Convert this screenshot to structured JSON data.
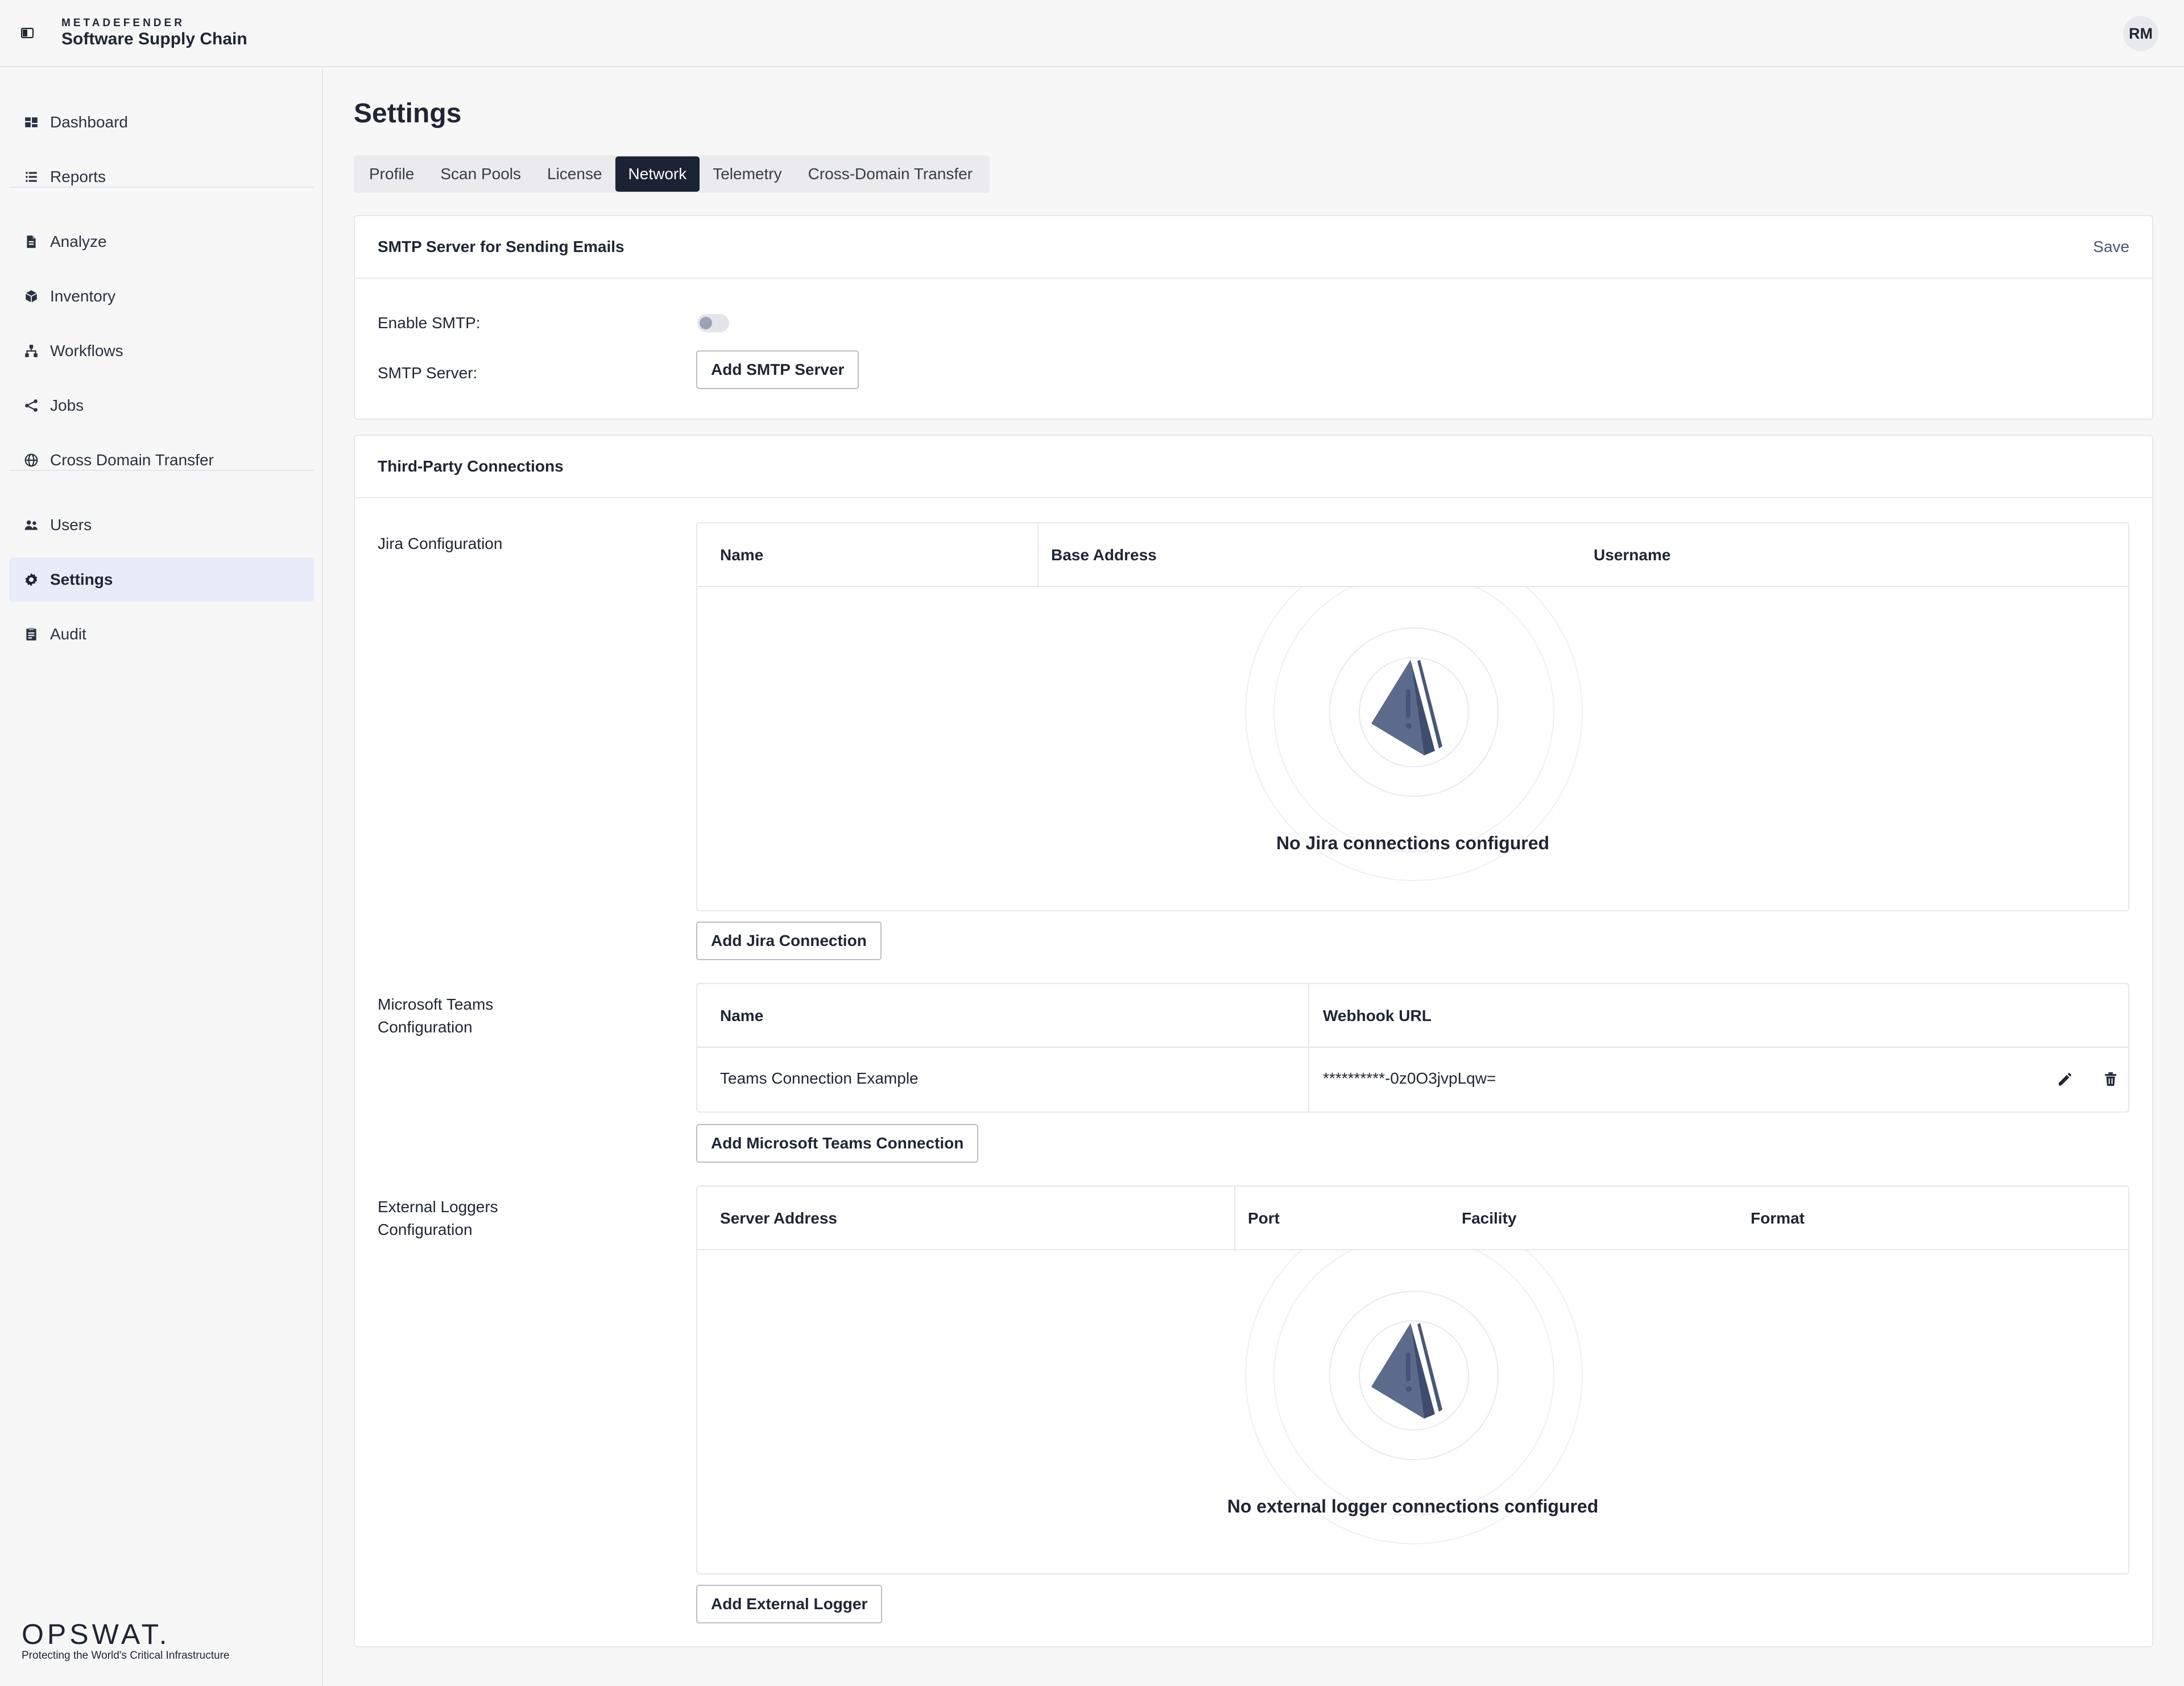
{
  "app": {
    "brand_small": "METADEFENDER",
    "brand_title": "Software Supply Chain",
    "user_initials": "RM"
  },
  "sidebar": {
    "items": [
      {
        "label": "Dashboard",
        "icon": "dashboard-icon"
      },
      {
        "label": "Reports",
        "icon": "reports-icon"
      },
      {
        "label": "Analyze",
        "icon": "analyze-icon"
      },
      {
        "label": "Inventory",
        "icon": "inventory-icon"
      },
      {
        "label": "Workflows",
        "icon": "workflows-icon"
      },
      {
        "label": "Jobs",
        "icon": "jobs-icon"
      },
      {
        "label": "Cross Domain Transfer",
        "icon": "globe-icon"
      },
      {
        "label": "Users",
        "icon": "users-icon"
      },
      {
        "label": "Settings",
        "icon": "gear-icon"
      },
      {
        "label": "Audit",
        "icon": "audit-icon"
      }
    ],
    "active": "Settings",
    "footer_logo": "OPSWAT.",
    "footer_tagline": "Protecting the World's Critical Infrastructure"
  },
  "page": {
    "title": "Settings",
    "tabs": [
      "Profile",
      "Scan Pools",
      "License",
      "Network",
      "Telemetry",
      "Cross-Domain Transfer"
    ],
    "active_tab": "Network"
  },
  "smtp": {
    "title": "SMTP Server for Sending Emails",
    "save_label": "Save",
    "enable_label": "Enable SMTP:",
    "server_label": "SMTP Server:",
    "add_button": "Add SMTP Server",
    "enabled": false
  },
  "third_party": {
    "title": "Third-Party Connections",
    "jira": {
      "label": "Jira Configuration",
      "columns": [
        "Name",
        "Base Address",
        "Username"
      ],
      "empty_message": "No Jira connections configured",
      "add_button": "Add Jira Connection"
    },
    "teams": {
      "label_line1": "Microsoft Teams",
      "label_line2": "Configuration",
      "columns": [
        "Name",
        "Webhook URL"
      ],
      "rows": [
        {
          "name": "Teams Connection Example",
          "webhook": "**********-0z0O3jvpLqw="
        }
      ],
      "add_button": "Add Microsoft Teams Connection"
    },
    "loggers": {
      "label_line1": "External Loggers",
      "label_line2": "Configuration",
      "columns": [
        "Server Address",
        "Port",
        "Facility",
        "Format"
      ],
      "empty_message": "No external logger connections configured",
      "add_button": "Add External Logger"
    }
  },
  "colors": {
    "accent_dark": "#1b2233",
    "active_nav_bg": "#e8ecf9",
    "illustration": "#5c6a8c"
  }
}
